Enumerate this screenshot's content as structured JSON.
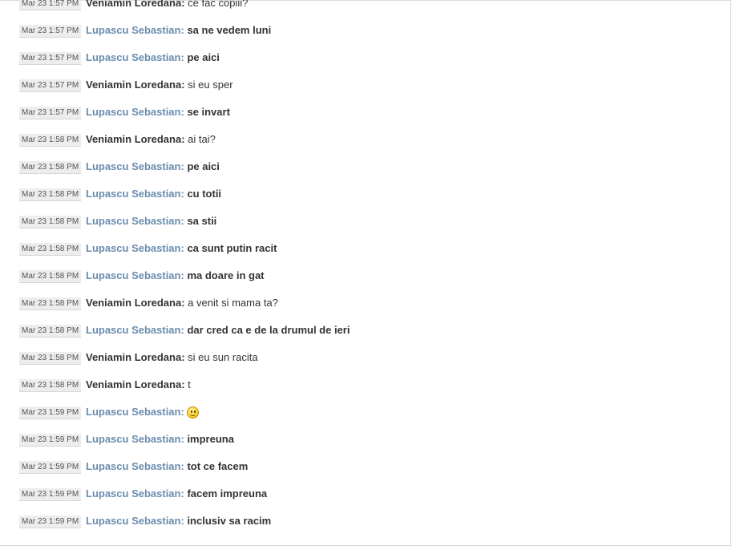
{
  "messages": [
    {
      "time": "Mar 23 1:57 PM",
      "sender": "Veniamin Loredana:",
      "text": "ce fac copiii?",
      "self": false
    },
    {
      "time": "Mar 23 1:57 PM",
      "sender": "Lupascu Sebastian:",
      "text": "sa ne vedem luni",
      "self": true
    },
    {
      "time": "Mar 23 1:57 PM",
      "sender": "Lupascu Sebastian:",
      "text": "pe aici",
      "self": true
    },
    {
      "time": "Mar 23 1:57 PM",
      "sender": "Veniamin Loredana:",
      "text": "si eu sper",
      "self": false
    },
    {
      "time": "Mar 23 1:57 PM",
      "sender": "Lupascu Sebastian:",
      "text": "se invart",
      "self": true
    },
    {
      "time": "Mar 23 1:58 PM",
      "sender": "Veniamin Loredana:",
      "text": "ai tai?",
      "self": false
    },
    {
      "time": "Mar 23 1:58 PM",
      "sender": "Lupascu Sebastian:",
      "text": "pe aici",
      "self": true
    },
    {
      "time": "Mar 23 1:58 PM",
      "sender": "Lupascu Sebastian:",
      "text": "cu totii",
      "self": true
    },
    {
      "time": "Mar 23 1:58 PM",
      "sender": "Lupascu Sebastian:",
      "text": "sa stii",
      "self": true
    },
    {
      "time": "Mar 23 1:58 PM",
      "sender": "Lupascu Sebastian:",
      "text": "ca sunt putin racit",
      "self": true
    },
    {
      "time": "Mar 23 1:58 PM",
      "sender": "Lupascu Sebastian:",
      "text": "ma doare in gat",
      "self": true
    },
    {
      "time": "Mar 23 1:58 PM",
      "sender": "Veniamin Loredana:",
      "text": "a venit si mama ta?",
      "self": false
    },
    {
      "time": "Mar 23 1:58 PM",
      "sender": "Lupascu Sebastian:",
      "text": "dar cred ca e de la drumul de ieri",
      "self": true
    },
    {
      "time": "Mar 23 1:58 PM",
      "sender": "Veniamin Loredana:",
      "text": "si eu sun racita",
      "self": false
    },
    {
      "time": "Mar 23 1:58 PM",
      "sender": "Veniamin Loredana:",
      "text": "t",
      "self": false
    },
    {
      "time": "Mar 23 1:59 PM",
      "sender": "Lupascu Sebastian:",
      "text": "",
      "emoticon": "smiley-icon",
      "self": true
    },
    {
      "time": "Mar 23 1:59 PM",
      "sender": "Lupascu Sebastian:",
      "text": "impreuna",
      "self": true
    },
    {
      "time": "Mar 23 1:59 PM",
      "sender": "Lupascu Sebastian:",
      "text": "tot ce facem",
      "self": true
    },
    {
      "time": "Mar 23 1:59 PM",
      "sender": "Lupascu Sebastian:",
      "text": "facem impreuna",
      "self": true
    },
    {
      "time": "Mar 23 1:59 PM",
      "sender": "Lupascu Sebastian:",
      "text": "inclusiv sa racim",
      "self": true
    }
  ],
  "colors": {
    "self_sender": "#6b8cad",
    "other_sender": "#333333",
    "timestamp_bg": "#ededed"
  }
}
